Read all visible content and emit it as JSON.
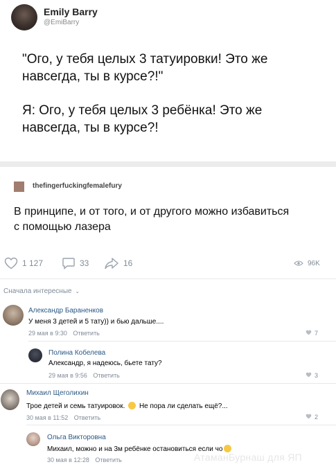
{
  "tweet": {
    "name": "Emily Barry",
    "handle": "@EmiBarry",
    "text_line1": "\"Ого, у тебя целых 3 татуировки! Это же",
    "text_line2": "навсегда, ты в курсе?!\"",
    "text_line3": "Я: Ого, у тебя целых 3 ребёнка! Это же",
    "text_line4": "навсегда, ты в курсе?!"
  },
  "reply": {
    "username": "thefingerfuckingfemalefury",
    "text_line1": "В принципе, и от того, и от другого можно избавиться",
    "text_line2": "с помощью лазера"
  },
  "actions": {
    "likes": "1 127",
    "comments": "33",
    "shares": "16",
    "views": "96K"
  },
  "sort_label": "Сначала интересные",
  "comments": [
    {
      "name": "Александр Бараненков",
      "text": "У меня 3 детей и 5 тату)) и бью дальше....",
      "time": "29 мая в 9:30",
      "reply_label": "Ответить",
      "likes": "7"
    },
    {
      "name": "Полина Кобелева",
      "text": "Александр, я надеюсь, бьете тату?",
      "time": "29 мая в 9:56",
      "reply_label": "Ответить",
      "likes": "3"
    },
    {
      "name": "Михаил Щеголихин",
      "text": "Трое детей и семь татуировок.",
      "text_after": "Не пора ли сделать ещё?...",
      "time": "30 мая в 11:52",
      "reply_label": "Ответить",
      "likes": "2"
    },
    {
      "name": "Ольга Викторовна",
      "text": "Михаил, можно и на 3м ребёнке остановиться если чо",
      "time": "30 мая в 12:28",
      "reply_label": "Ответить",
      "likes": ""
    }
  ],
  "watermark": "АтаманБурнаш для ЯП",
  "colors": {
    "link": "#2a5885",
    "muted": "#818c99",
    "band": "#ececec"
  },
  "icons": [
    "heart-icon",
    "comment-icon",
    "share-icon",
    "eye-icon",
    "chevron-down-icon",
    "thinking-emoji-icon",
    "grin-emoji-icon"
  ]
}
